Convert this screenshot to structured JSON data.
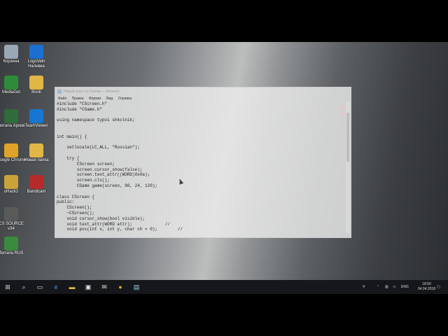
{
  "desktop_icons": [
    {
      "label": "Корзина",
      "color": "#9aa7b4",
      "icon": "recycle-bin-icon"
    },
    {
      "label": "LogoVeln Наливка",
      "color": "#1a6fd1",
      "icon": "app-icon"
    },
    {
      "label": "MediaGet",
      "color": "#2e8b3a",
      "icon": "app-icon"
    },
    {
      "label": "Book",
      "color": "#e2b646",
      "icon": "folder-icon"
    },
    {
      "label": "Terraria Архив",
      "color": "#2f6b3b",
      "icon": "app-icon"
    },
    {
      "label": "TeamViewer",
      "color": "#1676d2",
      "icon": "teamviewer-icon"
    },
    {
      "label": "Google Chrome",
      "color": "#e0a32a",
      "icon": "chrome-icon"
    },
    {
      "label": "Новая папка",
      "color": "#e2b646",
      "icon": "folder-icon"
    },
    {
      "label": "uHack2",
      "color": "#c9a33a",
      "icon": "app-icon"
    },
    {
      "label": "Bandicam",
      "color": "#b52a2a",
      "icon": "bandicam-icon"
    },
    {
      "label": "CS SOURCE v34",
      "color": "#5a5a5a",
      "icon": "cs-icon"
    },
    {
      "label": "Terraria RUS",
      "color": "#3a8b3e",
      "icon": "terraria-icon"
    }
  ],
  "window": {
    "title": "Новый текст на Ткачев — Блокнот",
    "menu": [
      "Файл",
      "Правка",
      "Формат",
      "Вид",
      "Справка"
    ],
    "code": "#include \"CScreen.h\"\n#include \"CGame.h\"\n\nusing namespace typoi shkolnik;\n\n\nint main() {\n\n    setlocale(LC_ALL, \"Russian\");\n\n    try {\n        CScreen screen;\n        screen.cursor_show(false);\n        screen.text_attr((WORD)0x0a);\n        screen.cls();\n        CGame game(screen, 80, 24, 120);\n\nclass CScreen {\npublic:\n    CScreen();\n    ~CScreen();\n    void cursor_show(bool visible);\n    void text_attr(WORD attr);             //\n    void pos(int x, int y, char ch = 0);        //"
  },
  "taskbar": {
    "tray_lang": "ENG",
    "time": "18:50",
    "date": "04.04.2018"
  }
}
